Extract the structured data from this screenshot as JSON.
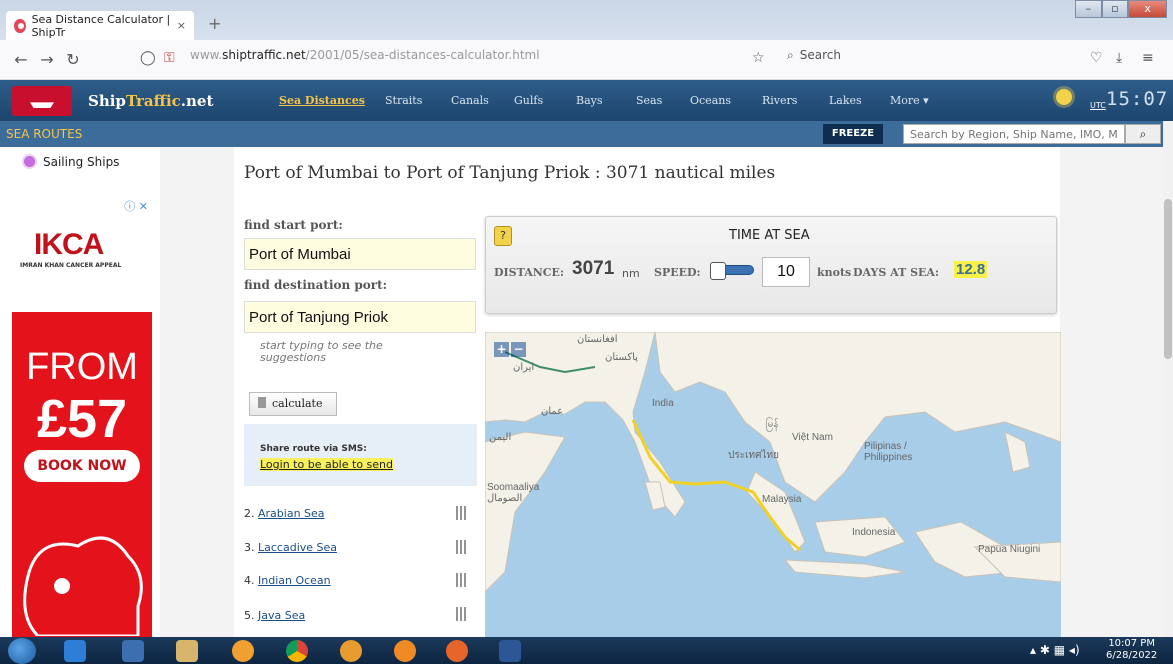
{
  "browser": {
    "tab_title": "Sea Distance Calculator | ShipTr",
    "tab_close": "×",
    "new_tab": "+",
    "url_prefix": "www.",
    "url_host": "shiptraffic.net",
    "url_path": "/2001/05/sea-distances-calculator.html",
    "search_placeholder": "Search",
    "window_controls": [
      "–",
      "▫",
      "x"
    ]
  },
  "site": {
    "brand_ship": "Ship",
    "brand_traffic": "Traffic",
    "brand_net": ".net",
    "nav": [
      "Sea Distances",
      "Straits",
      "Canals",
      "Gulfs",
      "Bays",
      "Seas",
      "Oceans",
      "Rivers",
      "Lakes",
      "More ▾"
    ],
    "utc": "UTC",
    "clock": "15:07",
    "section": "SEA ROUTES",
    "freeze": "FREEZE",
    "search_placeholder": "Search by Region, Ship Name, IMO, MMSI",
    "search_icon": "magnifier-icon"
  },
  "sidebar": {
    "item": "Sailing Ships"
  },
  "ad": {
    "brand": "IKCA",
    "brand_sub": "IMRAN KHAN CANCER APPEAL",
    "from": "FROM",
    "price": "£57",
    "button": "BOOK NOW"
  },
  "calculator": {
    "title": "Port of Mumbai to Port of Tanjung Priok : 3071 nautical miles",
    "start_label": "find start port:",
    "start_value": "Port of Mumbai",
    "dest_label": "find destination port:",
    "dest_value": "Port of Tanjung Priok",
    "hint": "start typing to see the suggestions",
    "calculate": "calculate",
    "share_label": "Share route via SMS:",
    "share_link": "Login to be able to send"
  },
  "route_items": [
    {
      "num": "2.",
      "name": "Arabian Sea"
    },
    {
      "num": "3.",
      "name": "Laccadive Sea"
    },
    {
      "num": "4.",
      "name": "Indian Ocean"
    },
    {
      "num": "5.",
      "name": "Java Sea"
    }
  ],
  "time_at_sea": {
    "help_icon": "?",
    "title": "TIME AT SEA",
    "distance_label": "DISTANCE:",
    "distance_value": "3071",
    "distance_unit": "nm",
    "speed_label": "SPEED:",
    "speed_value": "10",
    "speed_unit": "knots",
    "days_label": "DAYS AT SEA:",
    "days_value": "12.8"
  },
  "map": {
    "zoom_in": "+",
    "zoom_out": "−",
    "labels": [
      "ایران",
      "پاکستان",
      "India",
      "عمان",
      "اليمن",
      "ประเทศไทย",
      "Việt Nam",
      "Pilipinas / Philippines",
      "Soomaaliya الصومال",
      "Malaysia",
      "Indonesia",
      "Papua Niugini",
      "افغانستان",
      "မြန်"
    ]
  },
  "taskbar": {
    "time": "10:07 PM",
    "date": "6/28/2022"
  },
  "colors": {
    "header": "#1d456d",
    "accent": "#f6c445",
    "route_line": "#f2d125",
    "sea": "#a7cde8",
    "land": "#f4f1e9"
  }
}
